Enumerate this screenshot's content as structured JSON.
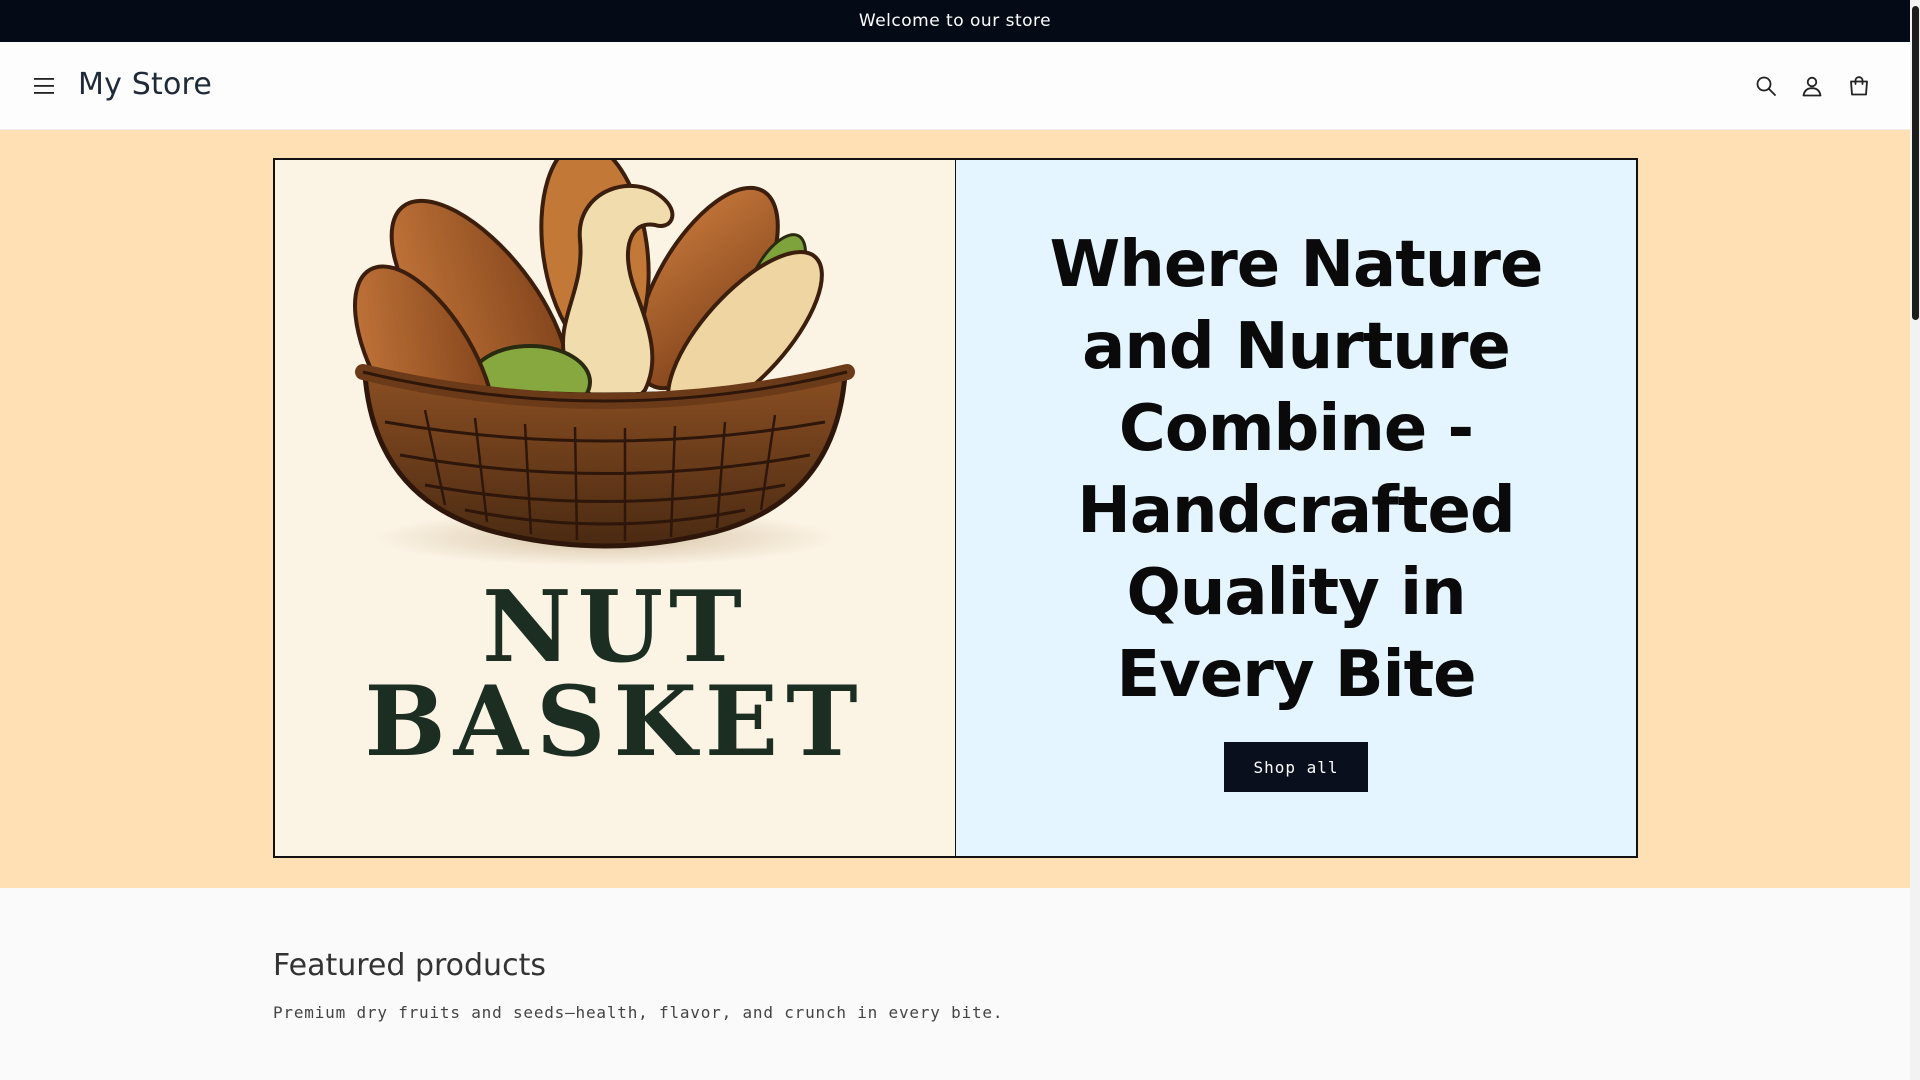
{
  "announcement": {
    "text": "Welcome to our store"
  },
  "header": {
    "store_name": "My Store",
    "icons": {
      "menu": "hamburger-menu-icon",
      "search": "search-icon",
      "account": "account-icon",
      "cart": "cart-icon"
    }
  },
  "hero": {
    "logo_line_1": "NUT",
    "logo_line_2": "BASKET",
    "heading": "Where Nature and Nurture Combine - Handcrafted Quality in Every Bite",
    "button_label": "Shop all",
    "colors": {
      "section_bg": "#ffdfb4",
      "content_bg": "#e5f5ff",
      "image_bg": "#fbf3e4",
      "button_bg": "#0a0f1e",
      "logo_text": "#1c2e22"
    }
  },
  "featured": {
    "title": "Featured products",
    "subtitle": "Premium dry fruits and seeds—health, flavor, and crunch in every bite."
  },
  "colors": {
    "announcement_bg": "#040b17",
    "header_bg": "#fdfdfd",
    "page_bg": "#fafafa"
  }
}
